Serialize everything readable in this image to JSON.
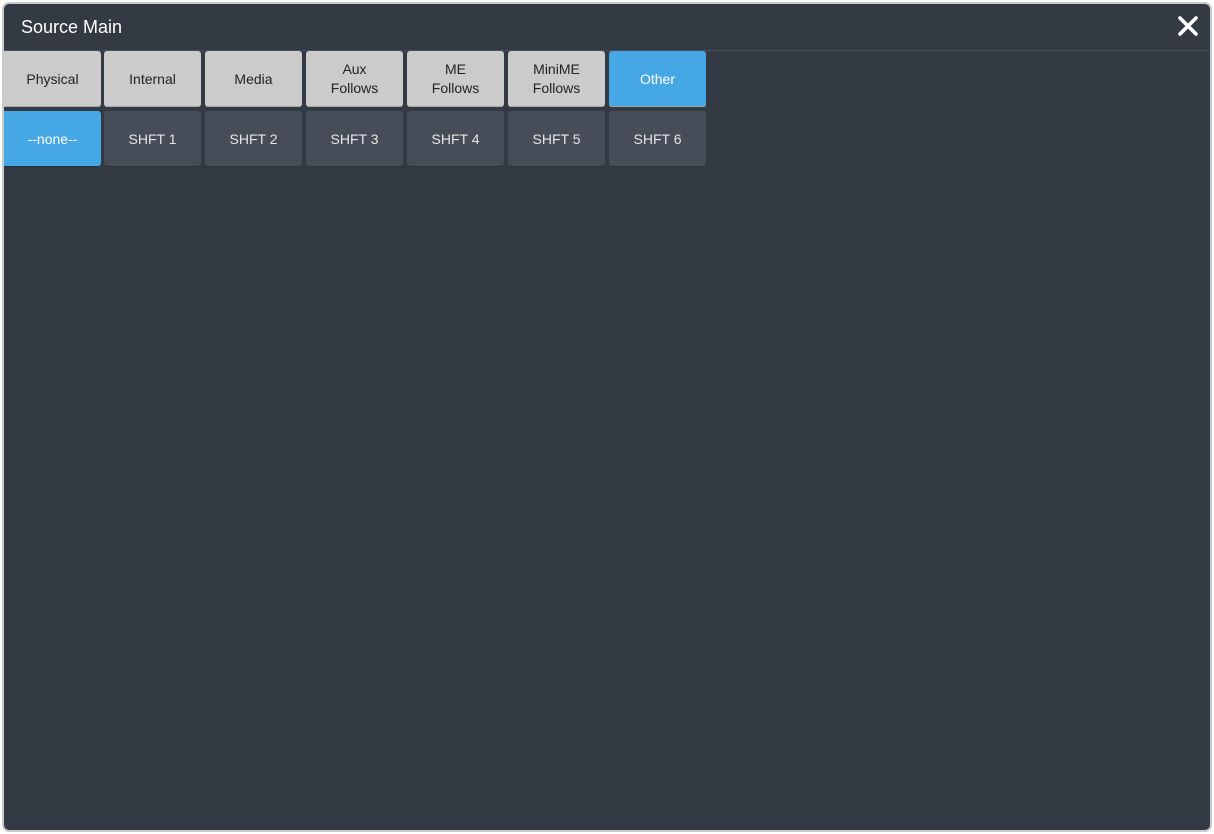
{
  "window": {
    "title": "Source Main",
    "close_icon": "close-icon"
  },
  "tabs": [
    {
      "label": "Physical",
      "selected": false
    },
    {
      "label": "Internal",
      "selected": false
    },
    {
      "label": "Media",
      "selected": false
    },
    {
      "label": "Aux\nFollows",
      "selected": false
    },
    {
      "label": "ME\nFollows",
      "selected": false
    },
    {
      "label": "MiniME\nFollows",
      "selected": false
    },
    {
      "label": "Other",
      "selected": true
    }
  ],
  "sources": [
    {
      "label": "--none--",
      "selected": true
    },
    {
      "label": "SHFT 1",
      "selected": false
    },
    {
      "label": "SHFT 2",
      "selected": false
    },
    {
      "label": "SHFT 3",
      "selected": false
    },
    {
      "label": "SHFT 4",
      "selected": false
    },
    {
      "label": "SHFT 5",
      "selected": false
    },
    {
      "label": "SHFT 6",
      "selected": false
    }
  ],
  "colors": {
    "background": "#343a43",
    "accent": "#46a7e5",
    "tab_button": "#cbcbcb",
    "source_button": "#474d58"
  }
}
